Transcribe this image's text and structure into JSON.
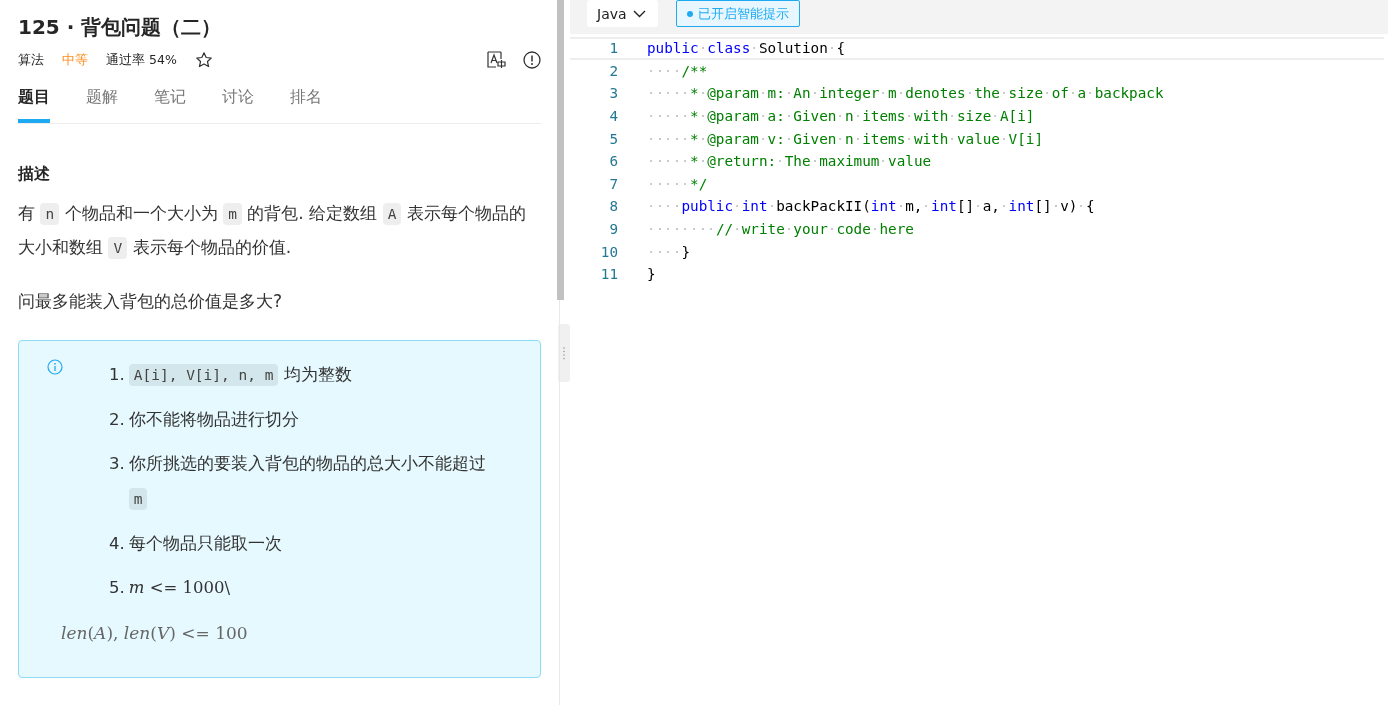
{
  "problem": {
    "title": "125 · 背包问题（二）",
    "category": "算法",
    "difficulty": "中等",
    "pass_rate": "通过率 54%",
    "starred": false,
    "tabs": [
      {
        "label": "题目",
        "selected": true
      },
      {
        "label": "题解",
        "selected": false
      },
      {
        "label": "笔记",
        "selected": false
      },
      {
        "label": "讨论",
        "selected": false
      },
      {
        "label": "排名",
        "selected": false
      }
    ],
    "section_title": "描述",
    "paragraphs": [
      [
        {
          "kind": "text",
          "text": "有 "
        },
        {
          "kind": "code",
          "text": "n"
        },
        {
          "kind": "text",
          "text": " 个物品和一个大小为 "
        },
        {
          "kind": "code",
          "text": "m"
        },
        {
          "kind": "text",
          "text": " 的背包. 给定数组 "
        },
        {
          "kind": "code",
          "text": "A"
        },
        {
          "kind": "text",
          "text": " 表示每个物品的大小和数组 "
        },
        {
          "kind": "code",
          "text": "V"
        },
        {
          "kind": "text",
          "text": " 表示每个物品的价值."
        }
      ],
      [
        {
          "kind": "text",
          "text": "问最多能装入背包的总价值是多大?"
        }
      ]
    ],
    "notes": [
      {
        "number": "1.",
        "parts": [
          {
            "kind": "code",
            "text": "A[i], V[i], n, m"
          },
          {
            "kind": "text",
            "text": " 均为整数"
          }
        ]
      },
      {
        "number": "2.",
        "parts": [
          {
            "kind": "text",
            "text": "你不能将物品进行切分"
          }
        ]
      },
      {
        "number": "3.",
        "parts": [
          {
            "kind": "text",
            "text": "你所挑选的要装入背包的物品的总大小不能超过 "
          },
          {
            "kind": "code",
            "text": "m"
          }
        ]
      },
      {
        "number": "4.",
        "parts": [
          {
            "kind": "text",
            "text": "每个物品只能取一次"
          }
        ]
      },
      {
        "number": "5.",
        "parts": [
          {
            "kind": "var",
            "text": "m"
          },
          {
            "kind": "num",
            "text": " <= 1000\\"
          }
        ]
      }
    ],
    "note_tail": [
      {
        "kind": "var",
        "text": "len"
      },
      {
        "kind": "num",
        "text": "("
      },
      {
        "kind": "var",
        "text": "A"
      },
      {
        "kind": "num",
        "text": "), "
      },
      {
        "kind": "var",
        "text": "len"
      },
      {
        "kind": "num",
        "text": "("
      },
      {
        "kind": "var",
        "text": "V"
      },
      {
        "kind": "num",
        "text": ") <= 100"
      }
    ]
  },
  "editor": {
    "language": "Java",
    "hint_button": "已开启智能提示",
    "hint_on": true,
    "lines": [
      {
        "number": "1",
        "current": true,
        "tokens": [
          {
            "kind": "keyword",
            "text": "public"
          },
          {
            "kind": "keyword",
            "text": " class"
          },
          {
            "kind": "plain",
            "text": " Solution {"
          }
        ]
      },
      {
        "number": "2",
        "current": false,
        "tokens": [
          {
            "kind": "comment",
            "text": "    /**"
          }
        ]
      },
      {
        "number": "3",
        "current": false,
        "tokens": [
          {
            "kind": "comment",
            "text": "     * @param m: An integer m denotes the size of a backpack"
          }
        ]
      },
      {
        "number": "4",
        "current": false,
        "tokens": [
          {
            "kind": "comment",
            "text": "     * @param a: Given n items with size A[i]"
          }
        ]
      },
      {
        "number": "5",
        "current": false,
        "tokens": [
          {
            "kind": "comment",
            "text": "     * @param v: Given n items with value V[i]"
          }
        ]
      },
      {
        "number": "6",
        "current": false,
        "tokens": [
          {
            "kind": "comment",
            "text": "     * @return: The maximum value"
          }
        ]
      },
      {
        "number": "7",
        "current": false,
        "tokens": [
          {
            "kind": "comment",
            "text": "     */"
          }
        ]
      },
      {
        "number": "8",
        "current": false,
        "tokens": [
          {
            "kind": "keyword",
            "text": "    public"
          },
          {
            "kind": "keyword",
            "text": " int"
          },
          {
            "kind": "plain",
            "text": " backPackII("
          },
          {
            "kind": "keyword",
            "text": "int"
          },
          {
            "kind": "plain",
            "text": " m, "
          },
          {
            "kind": "keyword",
            "text": "int"
          },
          {
            "kind": "plain",
            "text": "[] a, "
          },
          {
            "kind": "keyword",
            "text": "int"
          },
          {
            "kind": "plain",
            "text": "[] v) {"
          }
        ]
      },
      {
        "number": "9",
        "current": false,
        "tokens": [
          {
            "kind": "comment",
            "text": "        // write your code here"
          }
        ]
      },
      {
        "number": "10",
        "current": false,
        "tokens": [
          {
            "kind": "plain",
            "text": "    }"
          }
        ]
      },
      {
        "number": "11",
        "current": false,
        "tokens": [
          {
            "kind": "plain",
            "text": "}"
          }
        ]
      }
    ]
  }
}
